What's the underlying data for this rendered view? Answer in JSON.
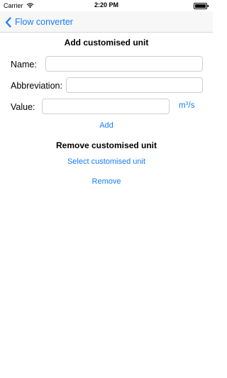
{
  "status_bar": {
    "carrier": "Carrier",
    "time": "2:20 PM",
    "wifi_icon": "wifi-icon",
    "battery_icon": "battery-icon"
  },
  "nav": {
    "back_label": "Flow converter",
    "back_icon": "chevron-left-icon"
  },
  "add_section": {
    "title": "Add customised unit",
    "name_label": "Name:",
    "name_value": "",
    "abbreviation_label": "Abbreviation:",
    "abbreviation_value": "",
    "value_label": "Value:",
    "value_value": "",
    "unit_base": "m",
    "unit_exp": "3",
    "unit_suffix": "/s",
    "add_button": "Add"
  },
  "remove_section": {
    "title": "Remove customised unit",
    "select_button": "Select customised unit",
    "remove_button": "Remove"
  },
  "colors": {
    "accent": "#147efb",
    "nav_background": "#f7f7f7",
    "field_border": "#cfcfd3"
  }
}
